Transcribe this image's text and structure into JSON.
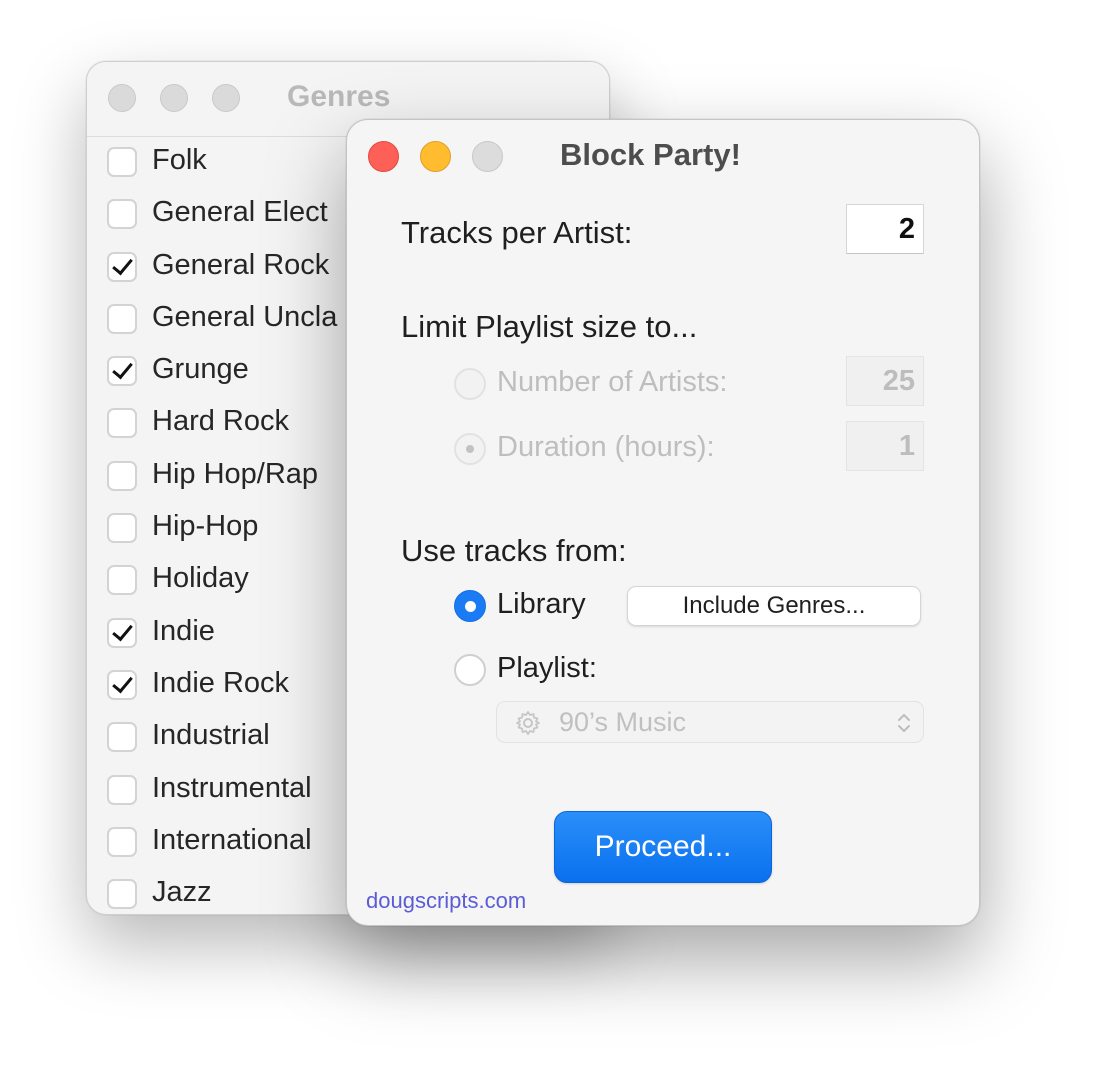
{
  "genres_window": {
    "title": "Genres",
    "items": [
      {
        "label": "Folk",
        "checked": false
      },
      {
        "label": "General Elect",
        "checked": false
      },
      {
        "label": "General Rock",
        "checked": true
      },
      {
        "label": "General Uncla",
        "checked": false
      },
      {
        "label": "Grunge",
        "checked": true
      },
      {
        "label": "Hard Rock",
        "checked": false
      },
      {
        "label": "Hip Hop/Rap",
        "checked": false
      },
      {
        "label": "Hip-Hop",
        "checked": false
      },
      {
        "label": "Holiday",
        "checked": false
      },
      {
        "label": "Indie",
        "checked": true
      },
      {
        "label": "Indie Rock",
        "checked": true
      },
      {
        "label": "Industrial",
        "checked": false
      },
      {
        "label": "Instrumental",
        "checked": false
      },
      {
        "label": "International",
        "checked": false
      },
      {
        "label": "Jazz",
        "checked": false
      }
    ]
  },
  "block_party": {
    "title": "Block Party!",
    "tracks_per_artist_label": "Tracks per Artist:",
    "tracks_per_artist_value": "2",
    "limit_label": "Limit Playlist size to...",
    "artists_label": "Number of Artists:",
    "artists_value": "25",
    "duration_label": "Duration (hours):",
    "duration_value": "1",
    "use_tracks_label": "Use tracks from:",
    "library_label": "Library",
    "include_genres_button": "Include Genres...",
    "playlist_label": "Playlist:",
    "playlist_selected": "90’s Music",
    "proceed_button": "Proceed...",
    "footer_link": "dougscripts.com"
  },
  "colors": {
    "accent": "#1a7bf4",
    "close": "#fe5f57",
    "minimize": "#febc2e",
    "link": "#5b5cd6"
  },
  "icons": {
    "playlist_popup": "gear-icon",
    "popup_arrows": "chevron-up-down-icon"
  }
}
